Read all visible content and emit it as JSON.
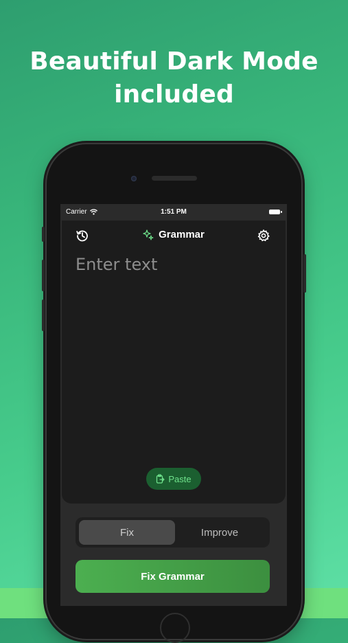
{
  "headline": {
    "line1": "Beautiful Dark Mode",
    "line2": "included"
  },
  "status_bar": {
    "carrier": "Carrier",
    "time": "1:51 PM"
  },
  "nav": {
    "title": "Grammar",
    "left_icon": "history-icon",
    "right_icon": "gear-icon",
    "title_icon": "sparkles-icon"
  },
  "editor": {
    "placeholder": "Enter text",
    "paste_label": "Paste",
    "paste_icon": "clipboard-icon"
  },
  "mode_selector": {
    "options": [
      "Fix",
      "Improve"
    ],
    "selected": "Fix"
  },
  "primary_action": {
    "label": "Fix Grammar"
  },
  "colors": {
    "accent": "#4caf50",
    "paste_text": "#6fe28c",
    "background_top": "#2e9e6f",
    "background_bottom": "#5fe0a6"
  }
}
